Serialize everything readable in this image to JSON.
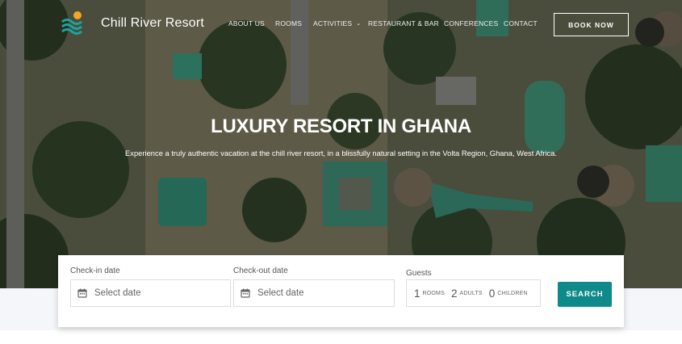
{
  "brand": {
    "name": "Chill River Resort"
  },
  "nav": {
    "items": [
      {
        "label": "ABOUT US"
      },
      {
        "label": "ROOMS"
      },
      {
        "label": "ACTIVITIES"
      },
      {
        "label": "RESTAURANT & BAR"
      },
      {
        "label": "CONFERENCES"
      },
      {
        "label": "CONTACT"
      }
    ],
    "book_label": "BOOK NOW"
  },
  "hero": {
    "title": "LUXURY RESORT IN GHANA",
    "subtitle": "Experience a truly authentic vacation at the chill river resort, in a blissfully natural setting in the Volta Region, Ghana, West Africa."
  },
  "booking": {
    "checkin_label": "Check-in date",
    "checkin_placeholder": "Select date",
    "checkout_label": "Check-out date",
    "checkout_placeholder": "Select date",
    "guests_label": "Guests",
    "rooms_count": "1",
    "rooms_label": "ROOMS",
    "adults_count": "2",
    "adults_label": "ADULTS",
    "children_count": "0",
    "children_label": "CHILDREN",
    "search_label": "SEARCH"
  },
  "colors": {
    "accent": "#0e8a8a",
    "band": "#f4f6f9"
  }
}
